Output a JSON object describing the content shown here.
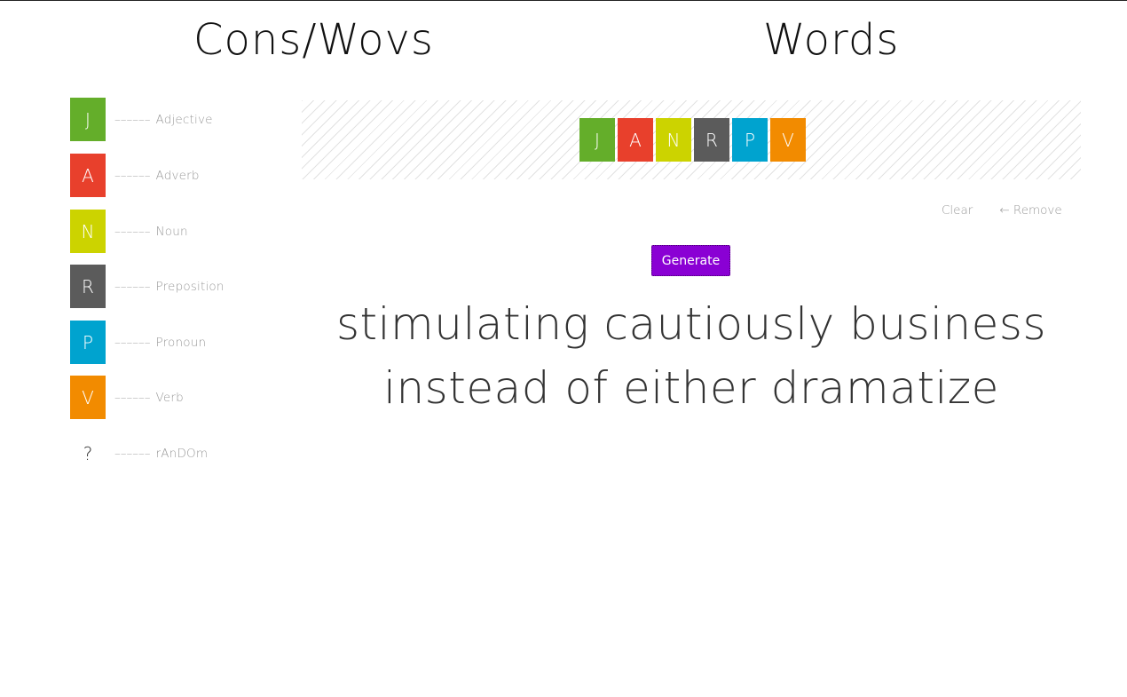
{
  "headings": {
    "left": "Cons/Wovs",
    "right": "Words"
  },
  "colors": {
    "J": "#64ae2a",
    "A": "#e8402c",
    "N": "#ccd300",
    "R": "#5b5b5b",
    "P": "#00a3cf",
    "V": "#f28b00",
    "generate_bg": "#8a00d4"
  },
  "legend": {
    "dashes": "––––––",
    "items": [
      {
        "letter": "J",
        "label": "Adjective"
      },
      {
        "letter": "A",
        "label": "Adverb"
      },
      {
        "letter": "N",
        "label": "Noun"
      },
      {
        "letter": "R",
        "label": "Preposition"
      },
      {
        "letter": "P",
        "label": "Pronoun"
      },
      {
        "letter": "V",
        "label": "Verb"
      },
      {
        "letter": "?",
        "label": "rAnDOm"
      }
    ]
  },
  "sequence": [
    "J",
    "A",
    "N",
    "R",
    "P",
    "V"
  ],
  "actions": {
    "clear": "Clear",
    "remove": "← Remove"
  },
  "generate_label": "Generate",
  "output_text": "stimulating cautiously business instead of either dramatize"
}
